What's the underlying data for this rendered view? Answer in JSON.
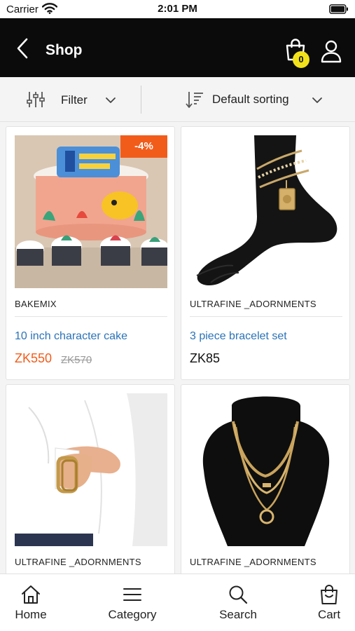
{
  "status_bar": {
    "carrier": "Carrier",
    "time": "2:01 PM"
  },
  "header": {
    "title": "Shop",
    "cart_count": "0"
  },
  "toolbar": {
    "filter_label": "Filter",
    "sort_label": "Default sorting"
  },
  "products": [
    {
      "vendor": "BAKEMIX",
      "name": "10 inch character cake",
      "price": "ZK550",
      "old_price": "ZK570",
      "discount": "-4%",
      "on_sale": true,
      "image": "cake-image"
    },
    {
      "vendor": "ULTRAFINE _ADORNMENTS",
      "name": "3 piece bracelet set",
      "price": "ZK85",
      "on_sale": false,
      "image": "anklet-image"
    },
    {
      "vendor": "ULTRAFINE _ADORNMENTS",
      "image": "bracelet-image"
    },
    {
      "vendor": "ULTRAFINE _ADORNMENTS",
      "image": "necklace-image"
    }
  ],
  "bottom_nav": [
    {
      "label": "Home",
      "icon": "home-icon"
    },
    {
      "label": "Category",
      "icon": "menu-icon"
    },
    {
      "label": "Search",
      "icon": "search-icon"
    },
    {
      "label": "Cart",
      "icon": "bag-icon"
    }
  ],
  "colors": {
    "header_bg": "#0b0b0b",
    "accent": "#f25c1b",
    "link": "#2a73b8",
    "badge": "#f2e21b"
  }
}
